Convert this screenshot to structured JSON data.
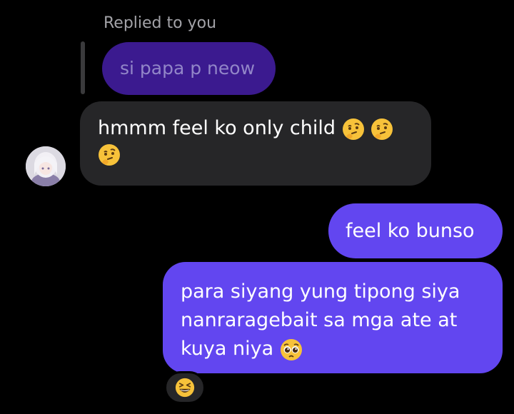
{
  "reply_context": {
    "label": "Replied to you",
    "quoted_text": "si papa p neow"
  },
  "messages": [
    {
      "direction": "incoming",
      "text": "hmmm feel ko only child",
      "emojis": [
        "thinking-face",
        "thinking-face",
        "thinking-face"
      ]
    },
    {
      "direction": "outgoing",
      "text": "feel ko bunso"
    },
    {
      "direction": "outgoing",
      "text": "para siyang yung tipong siya nanraragebait sa mga ate at kuya niya",
      "emojis": [
        "pleading-face"
      ]
    }
  ],
  "reaction": {
    "emoji": "grinning-squinting-face"
  },
  "colors": {
    "background": "#000000",
    "incoming_bubble": "#262628",
    "outgoing_bubble": "#6246f0",
    "quoted_bubble": "#3b1a8f",
    "quoted_text": "#9286c8",
    "label_text": "#a3a3a8"
  }
}
